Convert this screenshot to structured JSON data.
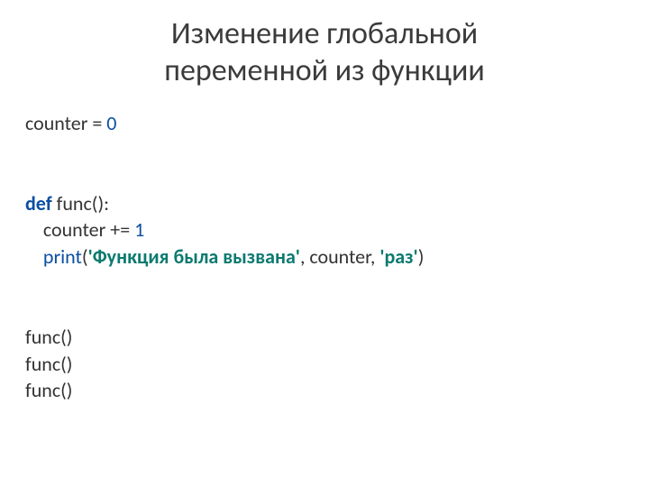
{
  "title_line1": "Изменение глобальной",
  "title_line2": "переменной из функции",
  "code": {
    "l1_var": "counter = ",
    "l1_num": "0",
    "l2_def": "def",
    "l2_rest": " func():",
    "l3": "    counter += ",
    "l3_num": "1",
    "l4_indent": "    ",
    "l4_print": "print",
    "l4_open": "(",
    "l4_str1": "'Функция была вызвана'",
    "l4_mid": ", counter, ",
    "l4_str2": "'раз'",
    "l4_close": ")",
    "l5": "func()",
    "l6": "func()",
    "l7": "func()"
  }
}
